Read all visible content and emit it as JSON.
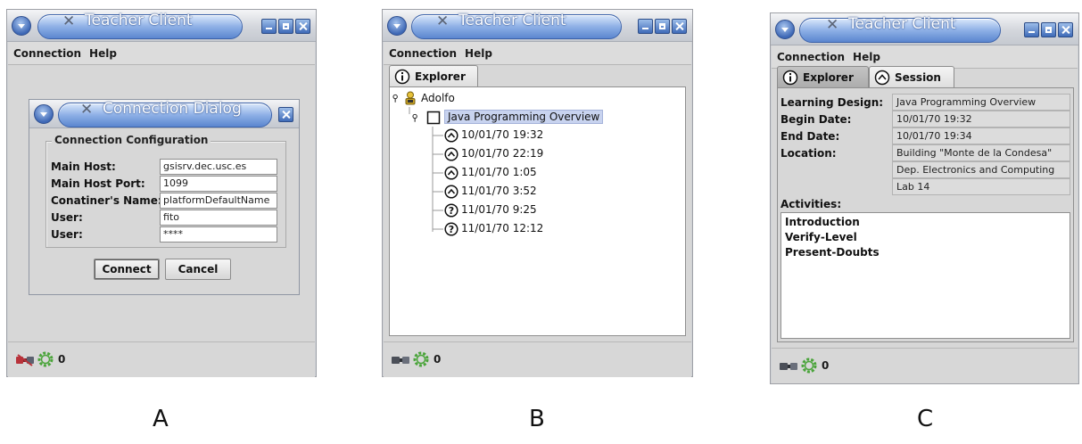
{
  "window_title": "Teacher Client",
  "menu": [
    "Connection",
    "Help"
  ],
  "status_count": "0",
  "panel_a": {
    "dialog": {
      "title": "Connection Dialog",
      "group_title": "Connection Configuration",
      "fields": [
        {
          "label": "Main Host:",
          "value": "gsisrv.dec.usc.es"
        },
        {
          "label": "Main Host Port:",
          "value": "1099"
        },
        {
          "label": "Conatiner's Name:",
          "value": "platformDefaultName"
        },
        {
          "label": "User:",
          "value": "fito"
        },
        {
          "label": "User:",
          "value": "****"
        }
      ],
      "connect_label": "Connect",
      "cancel_label": "Cancel"
    },
    "caption": "A"
  },
  "panel_b": {
    "tab": "Explorer",
    "tree": {
      "user": "Adolfo",
      "design": "Java Programming Overview",
      "sessions": [
        {
          "date": "10/01/70 19:32",
          "state": "started"
        },
        {
          "date": "10/01/70 22:19",
          "state": "started"
        },
        {
          "date": "11/01/70 1:05",
          "state": "started"
        },
        {
          "date": "11/01/70 3:52",
          "state": "started"
        },
        {
          "date": "11/01/70 9:25",
          "state": "unknown"
        },
        {
          "date": "11/01/70 12:12",
          "state": "unknown"
        }
      ]
    },
    "caption": "B"
  },
  "panel_c": {
    "tabs": [
      "Explorer",
      "Session"
    ],
    "fields": [
      {
        "label": "Learning Design:",
        "value": "Java Programming Overview"
      },
      {
        "label": "Begin Date:",
        "value": "10/01/70 19:32"
      },
      {
        "label": "End Date:",
        "value": "10/01/70 19:34"
      },
      {
        "label": "Location:",
        "value": "Building \"Monte de la Condesa\""
      }
    ],
    "location_extra": [
      "Dep. Electronics and Computing",
      "Lab 14"
    ],
    "activities_label": "Activities:",
    "activities": [
      "Introduction",
      "Verify-Level",
      "Present-Doubts"
    ],
    "caption": "C"
  },
  "colors": {
    "title_blue": "#5b86cf",
    "window_gray": "#d7d7d7",
    "selection": "#c8d3ef"
  }
}
